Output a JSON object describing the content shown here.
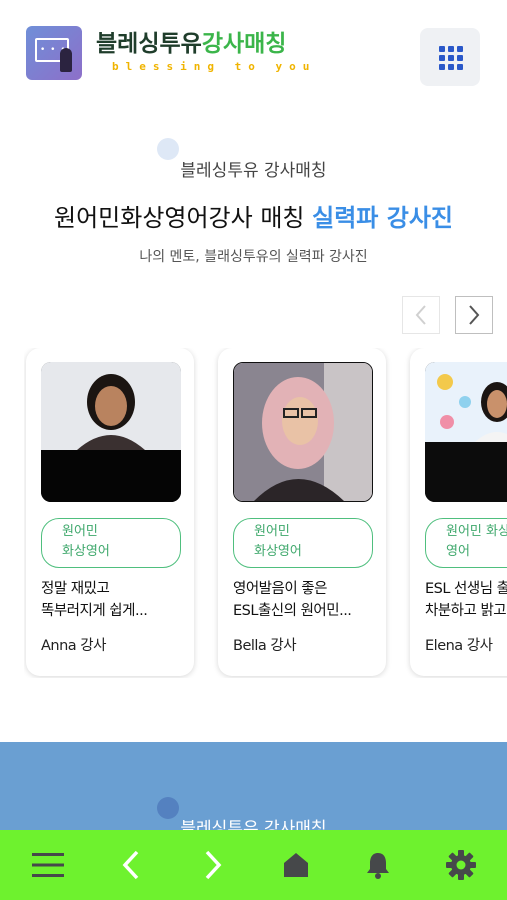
{
  "header": {
    "logo_title_part1": "블레싱투유",
    "logo_title_part2": "강사매칭",
    "logo_subtitle": "blessing to you",
    "menu_icon": "grid-icon",
    "accent_color": "#2a58c9"
  },
  "intro": {
    "small_title": "블레싱투유 강사매칭",
    "title_main": "원어민화상영어강사 매칭 ",
    "title_highlight": "실력파 강사진",
    "description": "나의 멘토, 블래싱투유의 실력파 강사진",
    "highlight_color": "#3a8ee6"
  },
  "carousel": {
    "prev_icon": "chevron-left-icon",
    "next_icon": "chevron-right-icon",
    "cards": [
      {
        "tag": "원어민\n화상영어",
        "description": "정말 재밌고\n똑부러지게 쉽게...",
        "name": "Anna 강사"
      },
      {
        "tag": "원어민\n화상영어",
        "description": "영어발음이 좋은\nESL출신의 원어민...",
        "name": "Bella 강사"
      },
      {
        "tag": "원어민 화상\n영어",
        "description": "ESL 선생님 출\n차분하고 밝고",
        "name": "Elena 강사"
      }
    ],
    "tag_color": "#3fa86c"
  },
  "band": {
    "text": "블레싱투유 강사매칭",
    "color": "#6a9fd2"
  },
  "bottom_nav": {
    "color": "#6ef22e",
    "items": [
      "hamburger-menu-icon",
      "back-arrow-icon",
      "forward-arrow-icon",
      "home-icon",
      "bell-icon",
      "gear-icon"
    ]
  }
}
